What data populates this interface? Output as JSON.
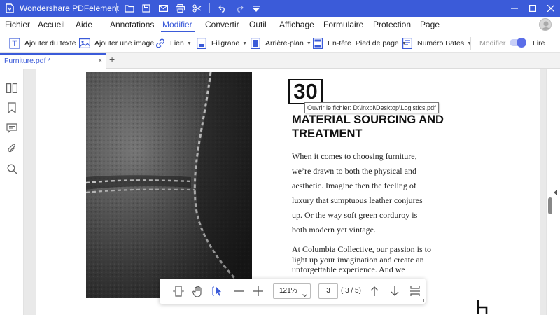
{
  "app": {
    "title": "Wondershare PDFelement"
  },
  "titlebar_icons": [
    "folder-icon",
    "save-icon",
    "mail-icon",
    "print-icon",
    "scissors-icon",
    "undo-icon",
    "redo-icon",
    "dropdown-icon"
  ],
  "menu": {
    "items": [
      "Fichier",
      "Accueil",
      "Aide",
      "Annotations",
      "Modifier",
      "Convertir",
      "Outil",
      "Affichage",
      "Formulaire",
      "Protection",
      "Page"
    ],
    "active": "Modifier"
  },
  "toolbar": {
    "add_text": "Ajouter du texte",
    "add_image": "Ajouter une image",
    "link": "Lien",
    "watermark": "Filigrane",
    "background": "Arrière-plan",
    "header": "En-tête",
    "footer": "Pied de page",
    "bates": "Numéro Bates",
    "modify": "Modifier",
    "read": "Lire"
  },
  "tabs": {
    "document": "Furniture.pdf *",
    "close": "×",
    "add": "+"
  },
  "sidebar_icons": [
    "thumbnails-icon",
    "bookmark-icon",
    "comment-icon",
    "attachment-icon",
    "search-icon"
  ],
  "document": {
    "page_number": "30",
    "tooltip": "Ouvrir le fichier: D:\\lnxpi\\Desktop\\Logistics.pdf",
    "heading": "MATERIAL SOURCING AND TREATMENT",
    "para1": "When it comes to choosing furniture, we’re drawn to both the physical and aesthetic. Imagine then the feeling of luxury that sumptuous leather conjures up. Or the way soft green corduroy is both modern yet vintage.",
    "para2": "At Columbia Collective, our passion is to light up your imagination and create an unforgettable experience. And we"
  },
  "floating_toolbar": {
    "zoom": "121%",
    "page_input": "3",
    "page_total": "( 3 / 5)"
  },
  "colors": {
    "accent": "#3b5bd9",
    "titlebar": "#3b5bd9",
    "toggle": "#5b6ee8"
  }
}
